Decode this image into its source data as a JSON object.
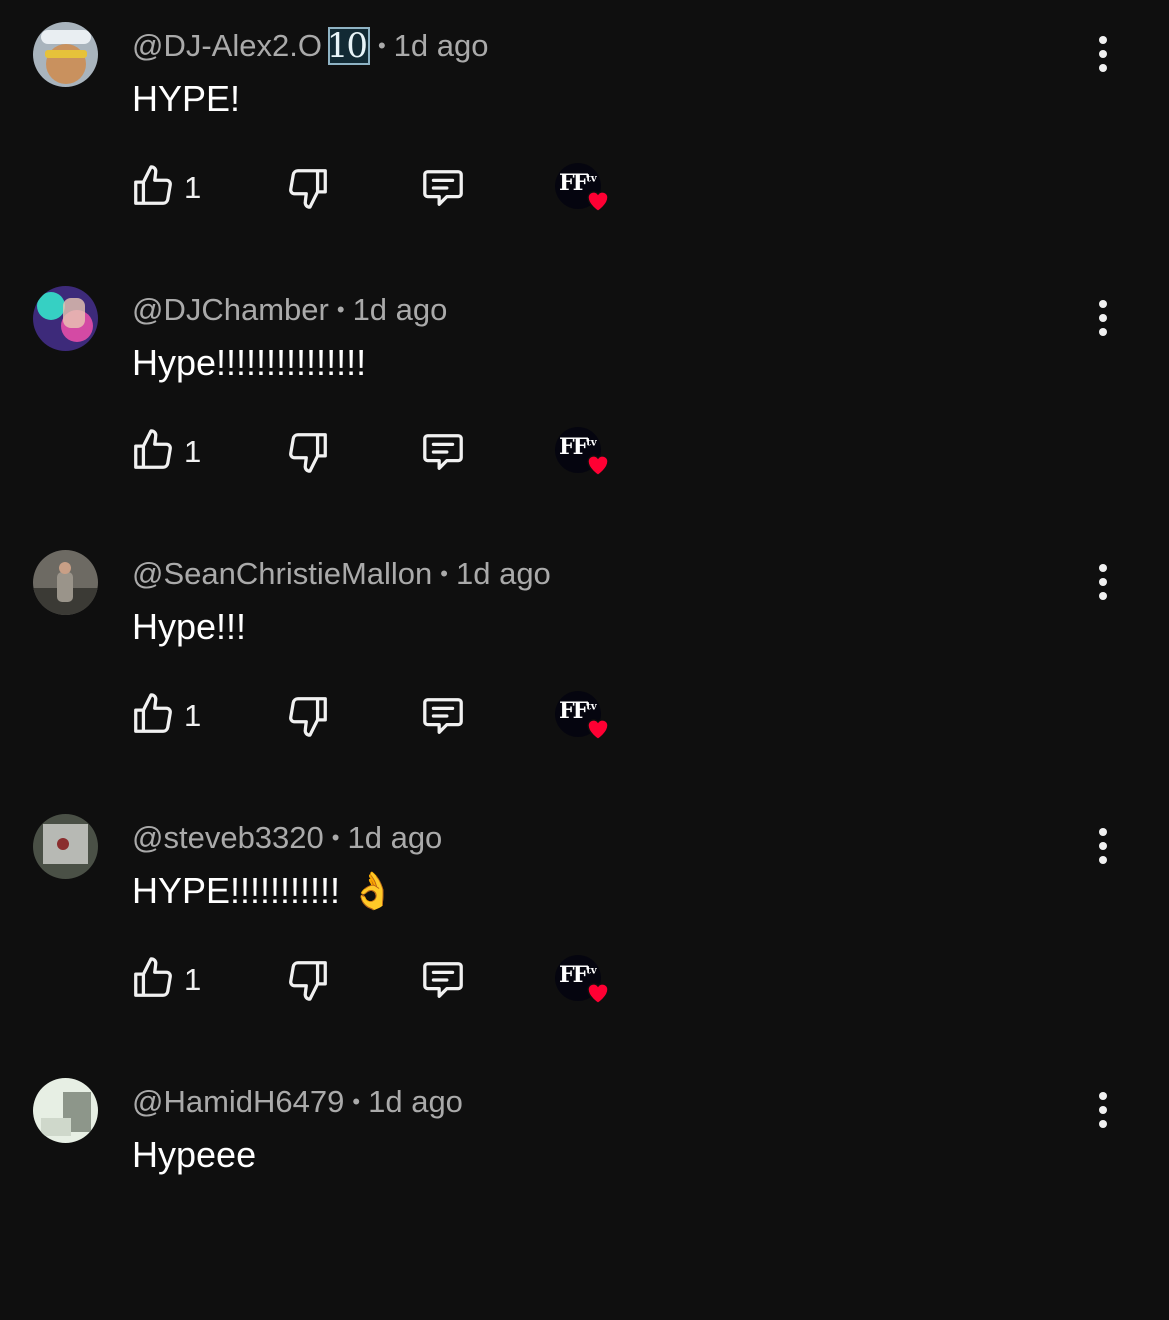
{
  "comments": [
    {
      "handle": "@DJ-Alex2.O",
      "badge": "10",
      "age": "1d ago",
      "text": "HYPE!",
      "likes": "1",
      "creator_logo": "FFtv",
      "avatar_colors": [
        "#a9b4bd",
        "#c9915e",
        "#3a2b1f"
      ]
    },
    {
      "handle": "@DJChamber",
      "badge": "",
      "age": "1d ago",
      "text": "Hype!!!!!!!!!!!!!!!",
      "likes": "1",
      "creator_logo": "FFtv",
      "avatar_colors": [
        "#3d2a7a",
        "#36d0c3",
        "#d44aa4"
      ]
    },
    {
      "handle": "@SeanChristieMallon",
      "badge": "",
      "age": "1d ago",
      "text": "Hype!!!",
      "likes": "1",
      "creator_logo": "FFtv",
      "avatar_colors": [
        "#6d6a63",
        "#9a948a",
        "#3b3a35"
      ]
    },
    {
      "handle": "@steveb3320",
      "badge": "",
      "age": "1d ago",
      "text": "HYPE!!!!!!!!!!! 👌",
      "likes": "1",
      "creator_logo": "FFtv",
      "avatar_colors": [
        "#b7b9b4",
        "#8a2e2e",
        "#4a5046"
      ]
    },
    {
      "handle": "@HamidH6479",
      "badge": "",
      "age": "1d ago",
      "text": "Hypeee",
      "likes": "",
      "creator_logo": "",
      "avatar_colors": [
        "#e7efe4",
        "#cfd8cb",
        "#8d968a"
      ]
    }
  ],
  "icons": {
    "like": "thumb-up-icon",
    "dislike": "thumb-down-icon",
    "reply": "comment-reply-icon",
    "more": "more-vert-icon",
    "creator_heart": "heart-icon"
  },
  "colors": {
    "background": "#0f0f0f",
    "meta": "#aaaaaa",
    "heart": "#ff0033"
  }
}
